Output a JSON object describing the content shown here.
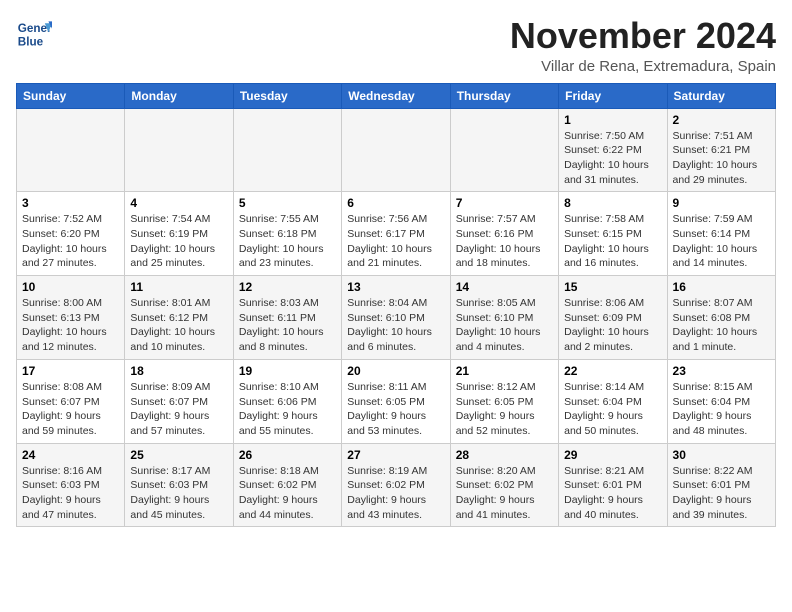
{
  "logo": {
    "line1": "General",
    "line2": "Blue"
  },
  "header": {
    "month": "November 2024",
    "location": "Villar de Rena, Extremadura, Spain"
  },
  "weekdays": [
    "Sunday",
    "Monday",
    "Tuesday",
    "Wednesday",
    "Thursday",
    "Friday",
    "Saturday"
  ],
  "weeks": [
    [
      {
        "day": "",
        "info": ""
      },
      {
        "day": "",
        "info": ""
      },
      {
        "day": "",
        "info": ""
      },
      {
        "day": "",
        "info": ""
      },
      {
        "day": "",
        "info": ""
      },
      {
        "day": "1",
        "info": "Sunrise: 7:50 AM\nSunset: 6:22 PM\nDaylight: 10 hours and 31 minutes."
      },
      {
        "day": "2",
        "info": "Sunrise: 7:51 AM\nSunset: 6:21 PM\nDaylight: 10 hours and 29 minutes."
      }
    ],
    [
      {
        "day": "3",
        "info": "Sunrise: 7:52 AM\nSunset: 6:20 PM\nDaylight: 10 hours and 27 minutes."
      },
      {
        "day": "4",
        "info": "Sunrise: 7:54 AM\nSunset: 6:19 PM\nDaylight: 10 hours and 25 minutes."
      },
      {
        "day": "5",
        "info": "Sunrise: 7:55 AM\nSunset: 6:18 PM\nDaylight: 10 hours and 23 minutes."
      },
      {
        "day": "6",
        "info": "Sunrise: 7:56 AM\nSunset: 6:17 PM\nDaylight: 10 hours and 21 minutes."
      },
      {
        "day": "7",
        "info": "Sunrise: 7:57 AM\nSunset: 6:16 PM\nDaylight: 10 hours and 18 minutes."
      },
      {
        "day": "8",
        "info": "Sunrise: 7:58 AM\nSunset: 6:15 PM\nDaylight: 10 hours and 16 minutes."
      },
      {
        "day": "9",
        "info": "Sunrise: 7:59 AM\nSunset: 6:14 PM\nDaylight: 10 hours and 14 minutes."
      }
    ],
    [
      {
        "day": "10",
        "info": "Sunrise: 8:00 AM\nSunset: 6:13 PM\nDaylight: 10 hours and 12 minutes."
      },
      {
        "day": "11",
        "info": "Sunrise: 8:01 AM\nSunset: 6:12 PM\nDaylight: 10 hours and 10 minutes."
      },
      {
        "day": "12",
        "info": "Sunrise: 8:03 AM\nSunset: 6:11 PM\nDaylight: 10 hours and 8 minutes."
      },
      {
        "day": "13",
        "info": "Sunrise: 8:04 AM\nSunset: 6:10 PM\nDaylight: 10 hours and 6 minutes."
      },
      {
        "day": "14",
        "info": "Sunrise: 8:05 AM\nSunset: 6:10 PM\nDaylight: 10 hours and 4 minutes."
      },
      {
        "day": "15",
        "info": "Sunrise: 8:06 AM\nSunset: 6:09 PM\nDaylight: 10 hours and 2 minutes."
      },
      {
        "day": "16",
        "info": "Sunrise: 8:07 AM\nSunset: 6:08 PM\nDaylight: 10 hours and 1 minute."
      }
    ],
    [
      {
        "day": "17",
        "info": "Sunrise: 8:08 AM\nSunset: 6:07 PM\nDaylight: 9 hours and 59 minutes."
      },
      {
        "day": "18",
        "info": "Sunrise: 8:09 AM\nSunset: 6:07 PM\nDaylight: 9 hours and 57 minutes."
      },
      {
        "day": "19",
        "info": "Sunrise: 8:10 AM\nSunset: 6:06 PM\nDaylight: 9 hours and 55 minutes."
      },
      {
        "day": "20",
        "info": "Sunrise: 8:11 AM\nSunset: 6:05 PM\nDaylight: 9 hours and 53 minutes."
      },
      {
        "day": "21",
        "info": "Sunrise: 8:12 AM\nSunset: 6:05 PM\nDaylight: 9 hours and 52 minutes."
      },
      {
        "day": "22",
        "info": "Sunrise: 8:14 AM\nSunset: 6:04 PM\nDaylight: 9 hours and 50 minutes."
      },
      {
        "day": "23",
        "info": "Sunrise: 8:15 AM\nSunset: 6:04 PM\nDaylight: 9 hours and 48 minutes."
      }
    ],
    [
      {
        "day": "24",
        "info": "Sunrise: 8:16 AM\nSunset: 6:03 PM\nDaylight: 9 hours and 47 minutes."
      },
      {
        "day": "25",
        "info": "Sunrise: 8:17 AM\nSunset: 6:03 PM\nDaylight: 9 hours and 45 minutes."
      },
      {
        "day": "26",
        "info": "Sunrise: 8:18 AM\nSunset: 6:02 PM\nDaylight: 9 hours and 44 minutes."
      },
      {
        "day": "27",
        "info": "Sunrise: 8:19 AM\nSunset: 6:02 PM\nDaylight: 9 hours and 43 minutes."
      },
      {
        "day": "28",
        "info": "Sunrise: 8:20 AM\nSunset: 6:02 PM\nDaylight: 9 hours and 41 minutes."
      },
      {
        "day": "29",
        "info": "Sunrise: 8:21 AM\nSunset: 6:01 PM\nDaylight: 9 hours and 40 minutes."
      },
      {
        "day": "30",
        "info": "Sunrise: 8:22 AM\nSunset: 6:01 PM\nDaylight: 9 hours and 39 minutes."
      }
    ]
  ]
}
